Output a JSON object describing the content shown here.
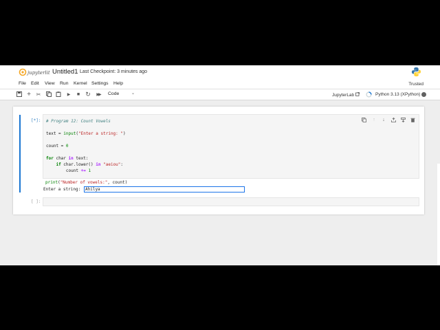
{
  "header": {
    "title": "Untitled1",
    "checkpoint": "Last Checkpoint: 3 minutes ago",
    "logo_icon": "jupyterlite-logo",
    "kernel_logo_icon": "python-logo-icon"
  },
  "menubar": {
    "items": [
      "File",
      "Edit",
      "View",
      "Run",
      "Kernel",
      "Settings",
      "Help"
    ],
    "trusted": "Trusted"
  },
  "toolbar": {
    "icons": [
      "save-icon",
      "add-cell-icon",
      "cut-icon",
      "copy-icon",
      "paste-icon",
      "run-icon",
      "stop-icon",
      "restart-icon",
      "run-all-icon"
    ],
    "cell_type": "Code",
    "jupyterlab_link": "JupyterLab",
    "kernel_name": "Python 3.13 (XPython)"
  },
  "cells": [
    {
      "prompt": "[*]:",
      "lines": [
        "# Program 12: Count Vowels",
        "",
        "text = input(\"Enter a string: \")",
        "",
        "count = 0",
        "",
        "for char in text:",
        "    if char.lower() in \"aeiou\":",
        "        count += 1",
        "",
        "print(\"Number of vowels:\", count)"
      ],
      "stdin_prompt": "Enter a string:",
      "stdin_value": "Ahilya"
    },
    {
      "prompt": "[ ]:"
    }
  ],
  "colors": {
    "accent": "#1976d2",
    "prompt": "#307fc1",
    "keyword": "#008000",
    "string": "#ba2121",
    "comment": "#408080"
  }
}
